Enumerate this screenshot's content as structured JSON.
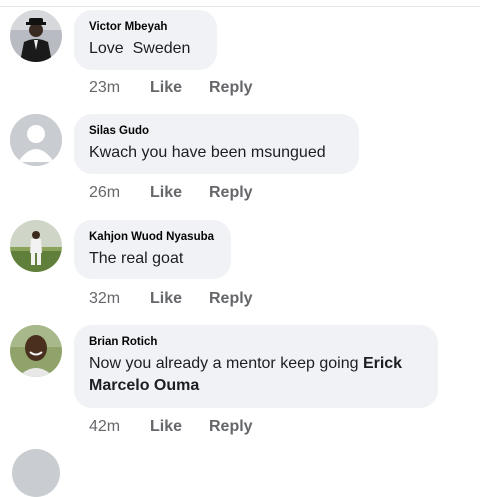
{
  "comments": [
    {
      "author": "Victor Mbeyah",
      "text": "Love  Sweden",
      "time": "23m",
      "like_label": "Like",
      "reply_label": "Reply",
      "avatar": "photo-man-in-suit"
    },
    {
      "author": "Silas Gudo",
      "text": "Kwach you have been msungued",
      "time": "26m",
      "like_label": "Like",
      "reply_label": "Reply",
      "avatar": "default-profile-silhouette"
    },
    {
      "author": "Kahjon Wuod Nyasuba",
      "text": "The real goat",
      "time": "32m",
      "like_label": "Like",
      "reply_label": "Reply",
      "avatar": "photo-person-on-field"
    },
    {
      "author": "Brian Rotich",
      "text_plain": "Now you already a mentor keep going ",
      "text_tag": "Erick Marcelo Ouma",
      "time": "42m",
      "like_label": "Like",
      "reply_label": "Reply",
      "avatar": "photo-smiling-man"
    }
  ],
  "colors": {
    "bubble": "#f0f2f5",
    "meta_text": "#65676b",
    "author_text": "#050505"
  }
}
